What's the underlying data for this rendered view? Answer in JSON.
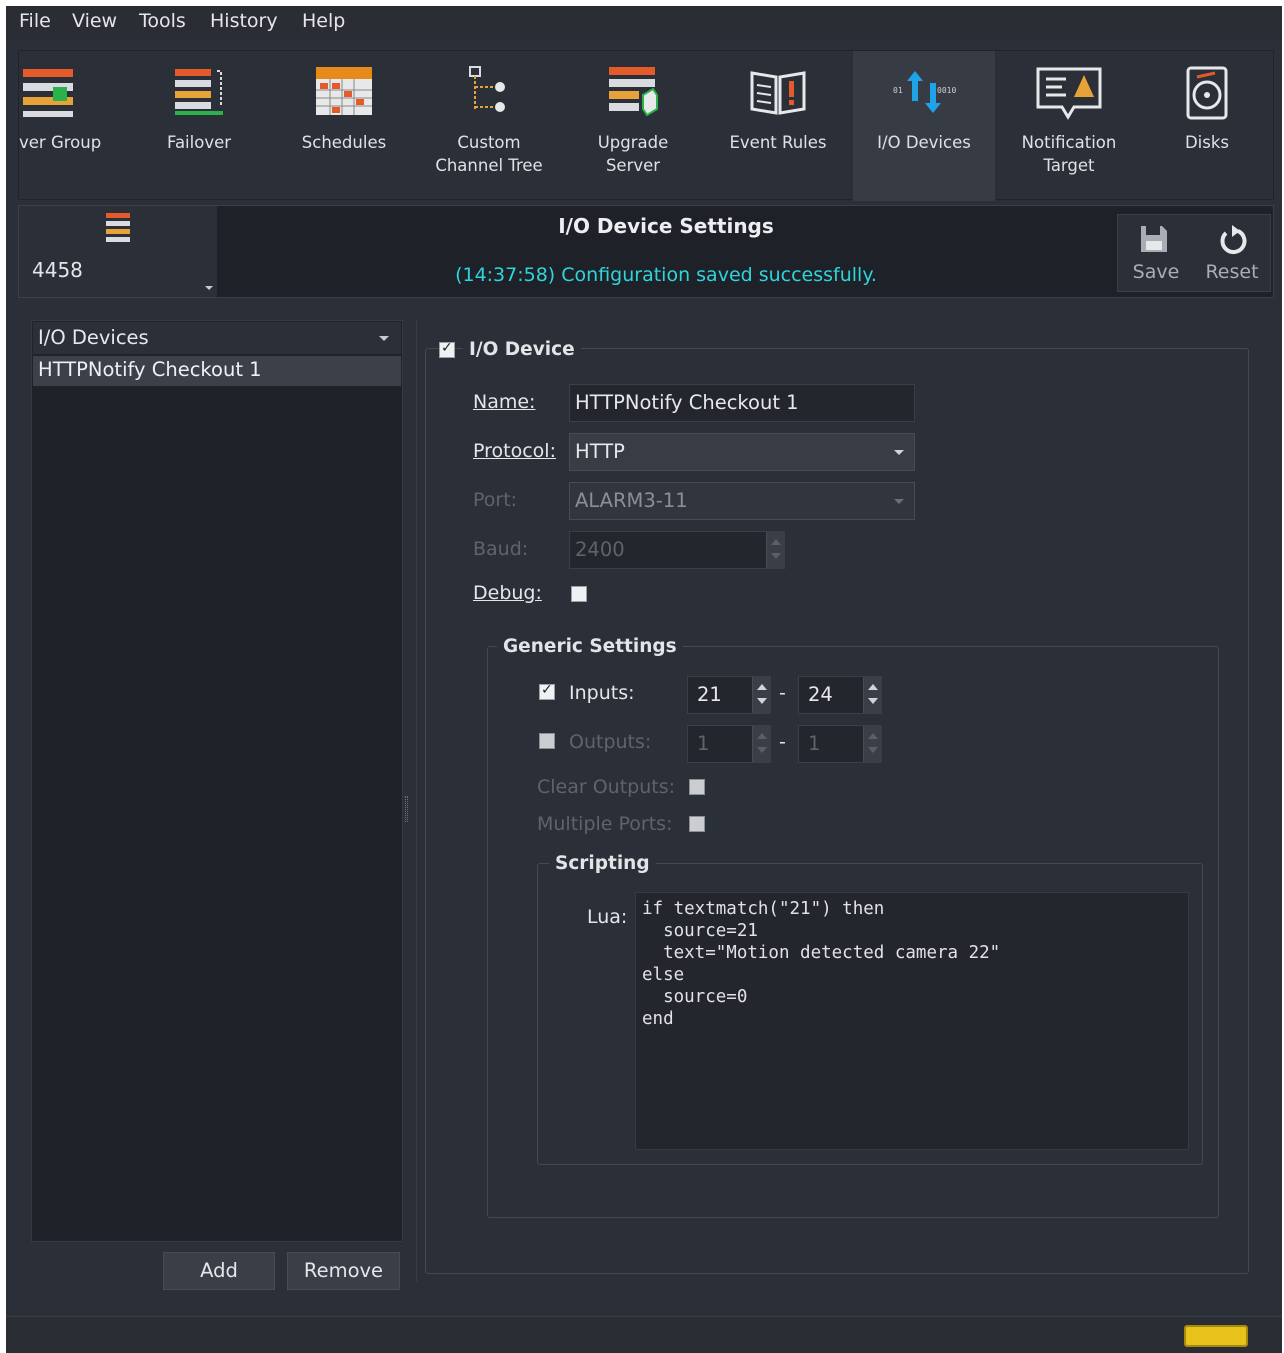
{
  "menu": [
    "File",
    "View",
    "Tools",
    "History",
    "Help"
  ],
  "toolbar": [
    {
      "label": "ver Group",
      "icon": "server-group-icon"
    },
    {
      "label": "Failover",
      "icon": "failover-icon"
    },
    {
      "label": "Schedules",
      "icon": "schedules-icon"
    },
    {
      "label": "Custom\nChannel Tree",
      "icon": "channel-tree-icon"
    },
    {
      "label": "Upgrade\nServer",
      "icon": "upgrade-server-icon"
    },
    {
      "label": "Event Rules",
      "icon": "event-rules-icon"
    },
    {
      "label": "I/O Devices",
      "icon": "io-devices-icon",
      "active": true
    },
    {
      "label": "Notification\nTarget",
      "icon": "notification-target-icon"
    },
    {
      "label": "Disks",
      "icon": "disks-icon"
    }
  ],
  "header": {
    "server_id": "4458",
    "title": "I/O Device Settings",
    "status": "(14:37:58) Configuration saved successfully.",
    "save_label": "Save",
    "reset_label": "Reset"
  },
  "left": {
    "combo_value": "I/O Devices",
    "items": [
      "HTTPNotify Checkout 1"
    ],
    "add_label": "Add",
    "remove_label": "Remove"
  },
  "device": {
    "group_title": "I/O Device",
    "enabled": true,
    "name_label": "Name:",
    "name_value": "HTTPNotify Checkout 1",
    "protocol_label": "Protocol:",
    "protocol_value": "HTTP",
    "port_label": "Port:",
    "port_value": "ALARM3-11",
    "baud_label": "Baud:",
    "baud_value": "2400",
    "debug_label": "Debug:",
    "debug_checked": false
  },
  "generic": {
    "group_title": "Generic Settings",
    "inputs_label": "Inputs:",
    "inputs_checked": true,
    "inputs_from": "21",
    "inputs_to": "24",
    "outputs_label": "Outputs:",
    "outputs_checked": false,
    "outputs_from": "1",
    "outputs_to": "1",
    "dash": "-",
    "clear_outputs_label": "Clear Outputs:",
    "multiple_ports_label": "Multiple Ports:"
  },
  "scripting": {
    "group_title": "Scripting",
    "lua_label": "Lua:",
    "code": "if textmatch(\"21\") then\n  source=21\n  text=\"Motion detected camera 22\"\nelse\n  source=0\nend"
  },
  "colors": {
    "accent_status": "#2fd5dc",
    "background": "#2b2f37",
    "indicator": "#e8c21a"
  }
}
